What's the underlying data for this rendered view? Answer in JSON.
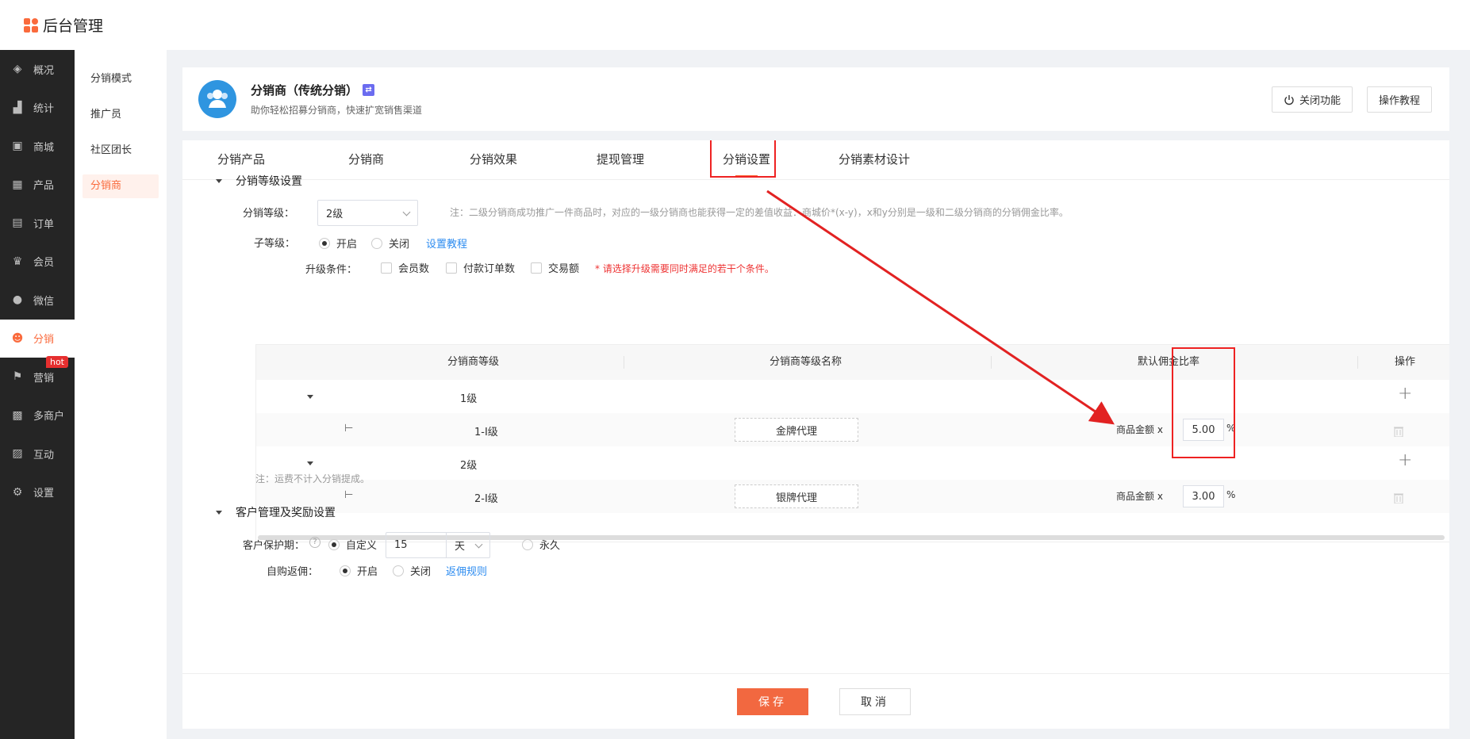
{
  "app": {
    "brand": "后台管理"
  },
  "nav": [
    {
      "label": "概况",
      "icon": "layers-icon",
      "glyph": "◈"
    },
    {
      "label": "统计",
      "icon": "chart-icon",
      "glyph": "▟"
    },
    {
      "label": "商城",
      "icon": "store-icon",
      "glyph": "▣"
    },
    {
      "label": "产品",
      "icon": "grid-icon",
      "glyph": "▦"
    },
    {
      "label": "订单",
      "icon": "order-icon",
      "glyph": "▤"
    },
    {
      "label": "会员",
      "icon": "crown-icon",
      "glyph": "♛"
    },
    {
      "label": "微信",
      "icon": "wechat-icon",
      "glyph": "●"
    },
    {
      "label": "分销",
      "icon": "users-icon",
      "glyph": "☻"
    },
    {
      "label": "营销",
      "icon": "flag-icon",
      "glyph": "⚑",
      "badge": "hot"
    },
    {
      "label": "多商户",
      "icon": "merchant-icon",
      "glyph": "▩"
    },
    {
      "label": "互动",
      "icon": "interact-icon",
      "glyph": "▨"
    },
    {
      "label": "设置",
      "icon": "gear-icon",
      "glyph": "⚙"
    }
  ],
  "subnav": [
    "分销模式",
    "推广员",
    "社区团长",
    "分销商"
  ],
  "plugin": {
    "title": "分销商（传统分销）",
    "badge": "⇄",
    "subtitle": "助你轻松招募分销商，快速扩宽销售渠道",
    "close_btn": "关闭功能",
    "tutorial_btn": "操作教程"
  },
  "tabs": [
    "分销产品",
    "分销商",
    "分销效果",
    "提现管理",
    "分销设置",
    "分销素材设计"
  ],
  "level_section": {
    "title": "分销等级设置",
    "level_label": "分销等级：",
    "level_value": "2级",
    "level_note": "注：二级分销商成功推广一件商品时，对应的一级分销商也能获得一定的差值收益：商城价*(x-y)，x和y分别是一级和二级分销商的分销佣金比率。",
    "sub_label": "子等级：",
    "sub_on": "开启",
    "sub_off": "关闭",
    "sub_link": "设置教程",
    "upgrade_label": "升级条件：",
    "upgrade_opts": [
      "会员数",
      "付款订单数",
      "交易额"
    ],
    "upgrade_warn": "* 请选择升级需要同时满足的若干个条件。",
    "footnote": "注：运费不计入分销提成。"
  },
  "table": {
    "headers": [
      "分销商等级",
      "分销商等级名称",
      "默认佣金比率",
      "操作"
    ],
    "rows": [
      {
        "type": "group",
        "level": "1级"
      },
      {
        "type": "child",
        "level": "1-I级",
        "name": "金牌代理",
        "rate_prefix": "商品金额 x",
        "rate": "5.00",
        "unit": "%"
      },
      {
        "type": "group",
        "level": "2级"
      },
      {
        "type": "child",
        "level": "2-I级",
        "name": "银牌代理",
        "rate_prefix": "商品金额 x",
        "rate": "3.00",
        "unit": "%"
      }
    ]
  },
  "customer_section": {
    "title": "客户管理及奖励设置",
    "protect_label": "客户保护期：",
    "custom": "自定义",
    "days": "15",
    "unit": "天",
    "forever": "永久",
    "rebate_label": "自购返佣：",
    "rebate_on": "开启",
    "rebate_off": "关闭",
    "rebate_link": "返佣规则"
  },
  "footer": {
    "save": "保存",
    "cancel": "取消"
  },
  "colors": {
    "accent": "#fa6a3c",
    "annotation": "#e22222",
    "link": "#2d8cf0"
  }
}
